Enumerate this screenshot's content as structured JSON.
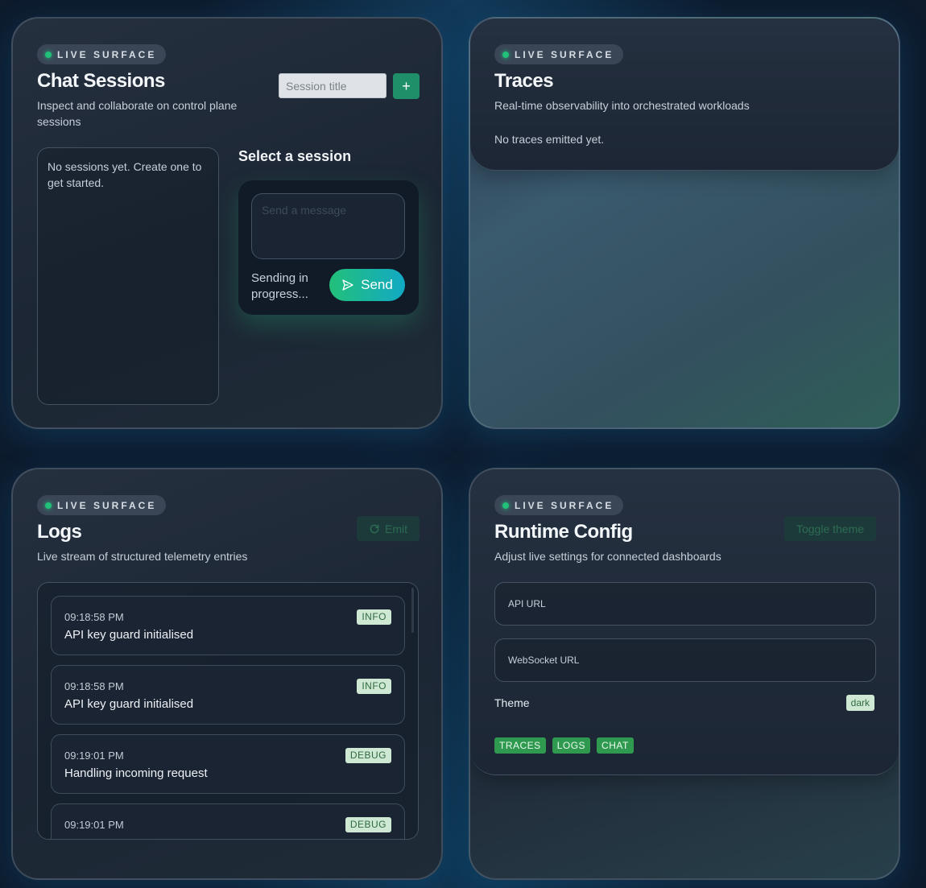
{
  "surface_label": "LIVE SURFACE",
  "colors": {
    "accent": "#22c07a",
    "accent_secondary": "#12a9c4",
    "background": "#0d1b2d",
    "panel": "#1c2634"
  },
  "chat": {
    "title": "Chat Sessions",
    "subtitle_line1": "Inspect and collaborate on control plane",
    "subtitle_line2": "sessions",
    "session_title_placeholder": "Session title",
    "add_label": "+",
    "empty_text": "No sessions yet. Create one to get started.",
    "select_heading": "Select a session",
    "message_placeholder": "Send a message",
    "sending_text": "Sending in progress...",
    "send_label": "Send",
    "send_icon": "send-icon"
  },
  "traces": {
    "title": "Traces",
    "subtitle": "Real-time observability into orchestrated workloads",
    "empty_text": "No traces emitted yet."
  },
  "logs": {
    "title": "Logs",
    "subtitle": "Live stream of structured telemetry entries",
    "emit_label": "Emit",
    "emit_icon": "refresh-icon",
    "entries": [
      {
        "time": "09:18:58 PM",
        "message": "API key guard initialised",
        "level": "INFO"
      },
      {
        "time": "09:18:58 PM",
        "message": "API key guard initialised",
        "level": "INFO"
      },
      {
        "time": "09:19:01 PM",
        "message": "Handling incoming request",
        "level": "DEBUG"
      },
      {
        "time": "09:19:01 PM",
        "message": "",
        "level": "DEBUG"
      }
    ]
  },
  "config": {
    "title": "Runtime Config",
    "subtitle": "Adjust live settings for connected dashboards",
    "toggle_label": "Toggle theme",
    "api_url_label": "API URL",
    "ws_url_label": "WebSocket URL",
    "theme_label": "Theme",
    "theme_value": "dark",
    "tags": [
      "TRACES",
      "LOGS",
      "CHAT"
    ]
  }
}
